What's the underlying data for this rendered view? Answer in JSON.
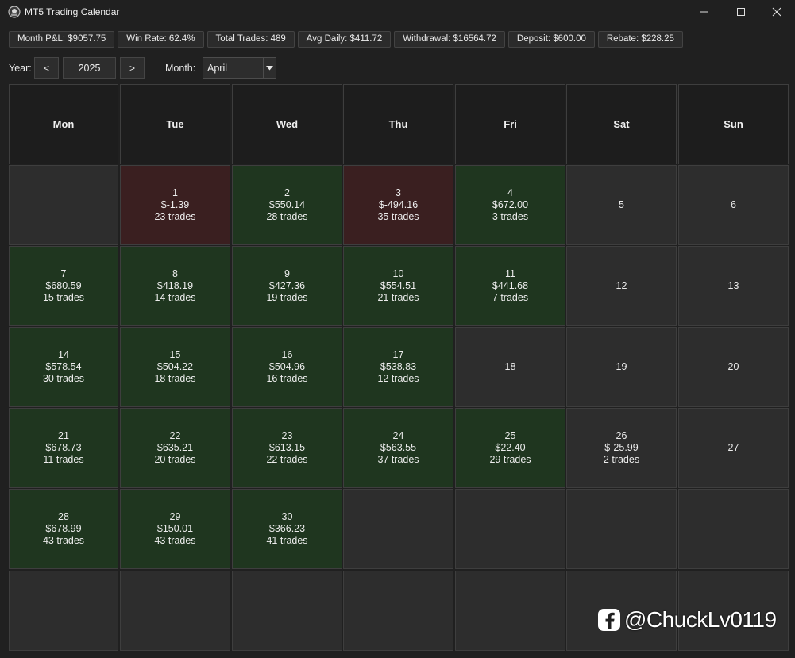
{
  "window": {
    "title": "MT5 Trading Calendar",
    "controls": [
      "minimize-icon",
      "maximize-icon",
      "close-icon"
    ]
  },
  "stats": [
    {
      "key": "month_pnl",
      "text": "Month P&L: $9057.75"
    },
    {
      "key": "win_rate",
      "text": "Win Rate: 62.4%"
    },
    {
      "key": "total_trades",
      "text": "Total Trades: 489"
    },
    {
      "key": "avg_daily",
      "text": "Avg Daily: $411.72"
    },
    {
      "key": "withdrawal",
      "text": "Withdrawal: $16564.72"
    },
    {
      "key": "deposit",
      "text": "Deposit: $600.00"
    },
    {
      "key": "rebate",
      "text": "Rebate: $228.25"
    }
  ],
  "nav": {
    "year_label": "Year:",
    "prev": "<",
    "year": "2025",
    "next": ">",
    "month_label": "Month:",
    "month": "April"
  },
  "weekdays": [
    "Mon",
    "Tue",
    "Wed",
    "Thu",
    "Fri",
    "Sat",
    "Sun"
  ],
  "colors": {
    "profit": "#1f361f",
    "loss": "#3a1f20",
    "neutral": "#2d2d2d"
  },
  "weeks": [
    [
      null,
      {
        "day": "1",
        "pnl": "$-1.39",
        "trades": "23 trades",
        "status": "loss"
      },
      {
        "day": "2",
        "pnl": "$550.14",
        "trades": "28 trades",
        "status": "profit"
      },
      {
        "day": "3",
        "pnl": "$-494.16",
        "trades": "35 trades",
        "status": "loss"
      },
      {
        "day": "4",
        "pnl": "$672.00",
        "trades": "3 trades",
        "status": "profit"
      },
      {
        "day": "5"
      },
      {
        "day": "6"
      }
    ],
    [
      {
        "day": "7",
        "pnl": "$680.59",
        "trades": "15 trades",
        "status": "profit"
      },
      {
        "day": "8",
        "pnl": "$418.19",
        "trades": "14 trades",
        "status": "profit"
      },
      {
        "day": "9",
        "pnl": "$427.36",
        "trades": "19 trades",
        "status": "profit"
      },
      {
        "day": "10",
        "pnl": "$554.51",
        "trades": "21 trades",
        "status": "profit"
      },
      {
        "day": "11",
        "pnl": "$441.68",
        "trades": "7 trades",
        "status": "profit"
      },
      {
        "day": "12"
      },
      {
        "day": "13"
      }
    ],
    [
      {
        "day": "14",
        "pnl": "$578.54",
        "trades": "30 trades",
        "status": "profit"
      },
      {
        "day": "15",
        "pnl": "$504.22",
        "trades": "18 trades",
        "status": "profit"
      },
      {
        "day": "16",
        "pnl": "$504.96",
        "trades": "16 trades",
        "status": "profit"
      },
      {
        "day": "17",
        "pnl": "$538.83",
        "trades": "12 trades",
        "status": "profit"
      },
      {
        "day": "18"
      },
      {
        "day": "19"
      },
      {
        "day": "20"
      }
    ],
    [
      {
        "day": "21",
        "pnl": "$678.73",
        "trades": "11 trades",
        "status": "profit"
      },
      {
        "day": "22",
        "pnl": "$635.21",
        "trades": "20 trades",
        "status": "profit"
      },
      {
        "day": "23",
        "pnl": "$613.15",
        "trades": "22 trades",
        "status": "profit"
      },
      {
        "day": "24",
        "pnl": "$563.55",
        "trades": "37 trades",
        "status": "profit"
      },
      {
        "day": "25",
        "pnl": "$22.40",
        "trades": "29 trades",
        "status": "profit"
      },
      {
        "day": "26",
        "pnl": "$-25.99",
        "trades": "2 trades",
        "status": "neutral"
      },
      {
        "day": "27"
      }
    ],
    [
      {
        "day": "28",
        "pnl": "$678.99",
        "trades": "43 trades",
        "status": "profit"
      },
      {
        "day": "29",
        "pnl": "$150.01",
        "trades": "43 trades",
        "status": "profit"
      },
      {
        "day": "30",
        "pnl": "$366.23",
        "trades": "41 trades",
        "status": "profit"
      },
      null,
      null,
      null,
      null
    ],
    [
      null,
      null,
      null,
      null,
      null,
      null,
      null
    ]
  ],
  "watermark": {
    "text": "@ChuckLv0119",
    "icon": "facebook-icon"
  }
}
